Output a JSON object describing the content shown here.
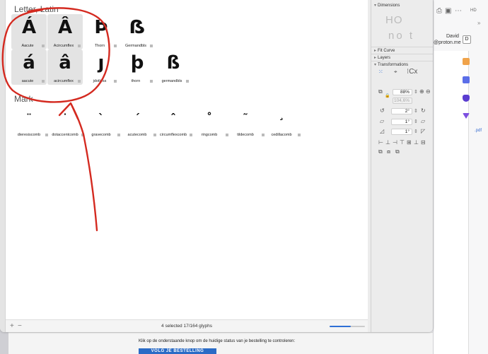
{
  "canvas": {
    "section_letter": "Letter, Latin",
    "section_mark": "Mark",
    "letters_row1": [
      {
        "char": "Á",
        "name": "Aacute",
        "selected": true
      },
      {
        "char": "Â",
        "name": "Acircumflex",
        "selected": true
      },
      {
        "char": "Þ",
        "name": "Thorn",
        "selected": false
      },
      {
        "char": "ẞ",
        "name": "Germandbls",
        "selected": false
      }
    ],
    "letters_row2": [
      {
        "char": "á",
        "name": "aacute",
        "selected": true
      },
      {
        "char": "â",
        "name": "acircumflex",
        "selected": true
      },
      {
        "char": "ȷ",
        "name": "jdotless",
        "selected": false
      },
      {
        "char": "þ",
        "name": "thorn",
        "selected": false
      },
      {
        "char": "ß",
        "name": "germandbls",
        "selected": false
      }
    ],
    "marks": [
      {
        "char": "̈",
        "display": "¨",
        "name": "dieresiscomb"
      },
      {
        "char": "̇",
        "display": "˙",
        "name": "dotaccentcomb"
      },
      {
        "char": "̀",
        "display": "`",
        "name": "gravecomb"
      },
      {
        "char": "́",
        "display": "´",
        "name": "acutecomb"
      },
      {
        "char": "̂",
        "display": "ˆ",
        "name": "circumflexcomb"
      },
      {
        "char": "̊",
        "display": "˚",
        "name": "ringcomb"
      },
      {
        "char": "̃",
        "display": "˜",
        "name": "tildecomb"
      },
      {
        "char": "̧",
        "display": "¸",
        "name": "cedillacomb"
      }
    ]
  },
  "statusbar": {
    "plus": "+",
    "minus": "−",
    "text": "4 selected 17/164 glyphs",
    "zoom_fraction": 0.6
  },
  "inspector": {
    "dimensions": "Dimensions",
    "dim_preview_1": "HO",
    "dim_preview_2": "no t",
    "fit_curve": "Fit Curve",
    "layers": "Layers",
    "transformations": "Transformations",
    "scale_value": "88%",
    "scale_secondary": "104,6%",
    "rotate_value": "2°",
    "skew_value_1": "1°",
    "skew_value_2": "1°",
    "cx_label": "Cx"
  },
  "background": {
    "email_text": "Klik op de onderstaande knop om de huidige status van je bestelling te controleren:",
    "email_button": "VOLG JE BESTELLING",
    "user_name": "David",
    "user_email": "@proton.me",
    "avatar_letter": "D",
    "pdf_label": ".pdf",
    "hd_label": "HD"
  },
  "colors": {
    "annotation": "#d42a20",
    "selection": "#e3e3e3",
    "accent": "#2f6fd6"
  }
}
